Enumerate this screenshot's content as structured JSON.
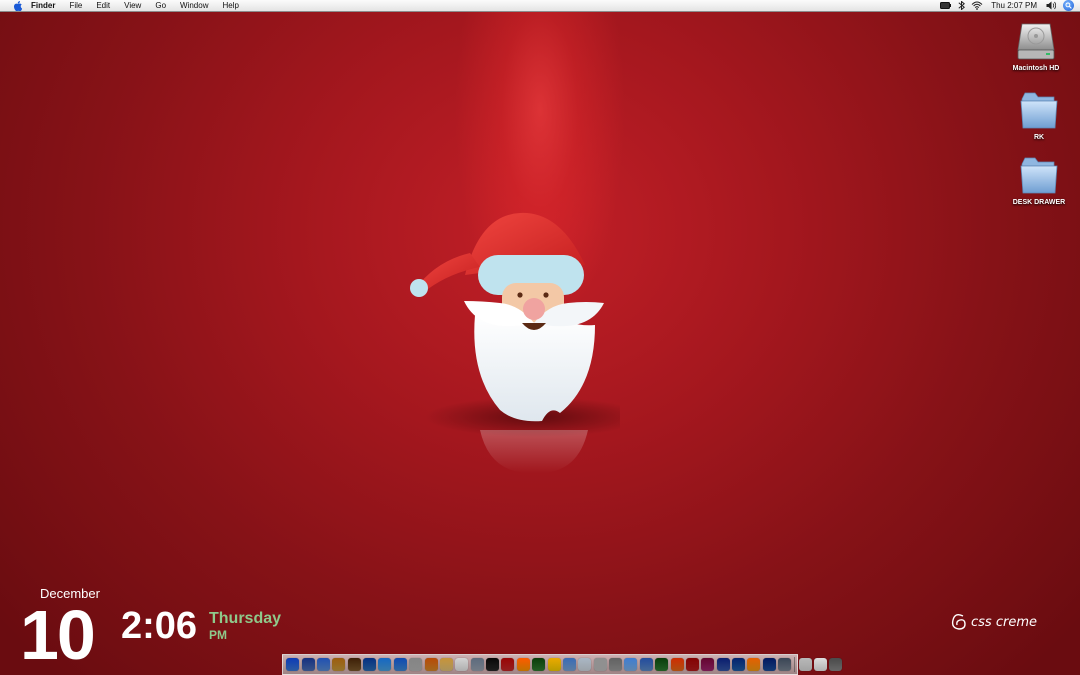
{
  "menubar": {
    "apple_icon": "apple-icon",
    "app_name": "Finder",
    "items": [
      "File",
      "Edit",
      "View",
      "Go",
      "Window",
      "Help"
    ],
    "status_icons": [
      "battery-icon",
      "bluetooth-icon",
      "wifi-icon"
    ],
    "clock": "Thu 2:07 PM",
    "right_icons": [
      "volume-icon",
      "spotlight-icon"
    ]
  },
  "desktop": {
    "icons": [
      {
        "label": "Macintosh HD",
        "icon": "hard-drive-icon"
      },
      {
        "label": "RK",
        "icon": "folder-icon"
      },
      {
        "label": "DESK DRAWER",
        "icon": "folder-icon"
      }
    ],
    "wallpaper": {
      "accent": "#c21f27",
      "background": "#861217"
    }
  },
  "widget": {
    "month": "December",
    "day": "10",
    "time": "2:06",
    "weekday": "Thursday",
    "ampm": "PM",
    "accent": "#8fc98b"
  },
  "logo": {
    "text": "css creme"
  },
  "dock": {
    "apps": [
      "finder",
      "dashboard",
      "safari",
      "photo",
      "game",
      "automator",
      "itunes",
      "app-store",
      "disk-utility",
      "preview",
      "finder-2",
      "calendar",
      "system-preferences",
      "terminal",
      "photo-booth",
      "vlc",
      "adium",
      "stickies",
      "textedit",
      "preview-2",
      "ical",
      "address-book",
      "mail",
      "transmission",
      "dreamweaver",
      "firefox",
      "flash",
      "indesign",
      "illustrator-v",
      "photoshop",
      "illustrator",
      "google-earth",
      "settings"
    ],
    "trailing": [
      "downloads",
      "documents",
      "trash"
    ]
  }
}
